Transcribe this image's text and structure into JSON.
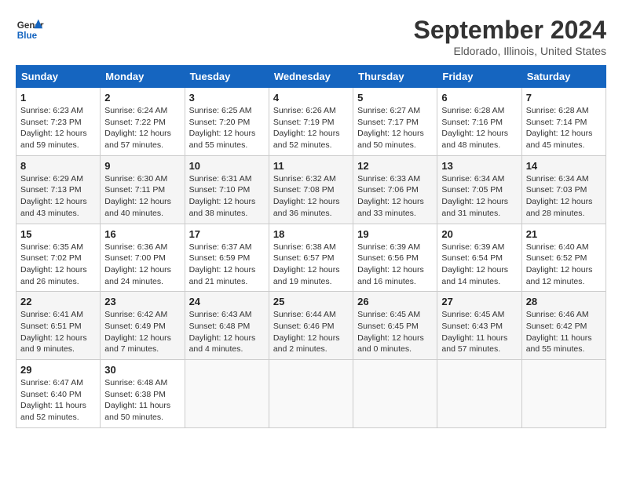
{
  "header": {
    "logo_line1": "General",
    "logo_line2": "Blue",
    "month": "September 2024",
    "location": "Eldorado, Illinois, United States"
  },
  "weekdays": [
    "Sunday",
    "Monday",
    "Tuesday",
    "Wednesday",
    "Thursday",
    "Friday",
    "Saturday"
  ],
  "weeks": [
    [
      {
        "day": "1",
        "info": "Sunrise: 6:23 AM\nSunset: 7:23 PM\nDaylight: 12 hours\nand 59 minutes."
      },
      {
        "day": "2",
        "info": "Sunrise: 6:24 AM\nSunset: 7:22 PM\nDaylight: 12 hours\nand 57 minutes."
      },
      {
        "day": "3",
        "info": "Sunrise: 6:25 AM\nSunset: 7:20 PM\nDaylight: 12 hours\nand 55 minutes."
      },
      {
        "day": "4",
        "info": "Sunrise: 6:26 AM\nSunset: 7:19 PM\nDaylight: 12 hours\nand 52 minutes."
      },
      {
        "day": "5",
        "info": "Sunrise: 6:27 AM\nSunset: 7:17 PM\nDaylight: 12 hours\nand 50 minutes."
      },
      {
        "day": "6",
        "info": "Sunrise: 6:28 AM\nSunset: 7:16 PM\nDaylight: 12 hours\nand 48 minutes."
      },
      {
        "day": "7",
        "info": "Sunrise: 6:28 AM\nSunset: 7:14 PM\nDaylight: 12 hours\nand 45 minutes."
      }
    ],
    [
      {
        "day": "8",
        "info": "Sunrise: 6:29 AM\nSunset: 7:13 PM\nDaylight: 12 hours\nand 43 minutes."
      },
      {
        "day": "9",
        "info": "Sunrise: 6:30 AM\nSunset: 7:11 PM\nDaylight: 12 hours\nand 40 minutes."
      },
      {
        "day": "10",
        "info": "Sunrise: 6:31 AM\nSunset: 7:10 PM\nDaylight: 12 hours\nand 38 minutes."
      },
      {
        "day": "11",
        "info": "Sunrise: 6:32 AM\nSunset: 7:08 PM\nDaylight: 12 hours\nand 36 minutes."
      },
      {
        "day": "12",
        "info": "Sunrise: 6:33 AM\nSunset: 7:06 PM\nDaylight: 12 hours\nand 33 minutes."
      },
      {
        "day": "13",
        "info": "Sunrise: 6:34 AM\nSunset: 7:05 PM\nDaylight: 12 hours\nand 31 minutes."
      },
      {
        "day": "14",
        "info": "Sunrise: 6:34 AM\nSunset: 7:03 PM\nDaylight: 12 hours\nand 28 minutes."
      }
    ],
    [
      {
        "day": "15",
        "info": "Sunrise: 6:35 AM\nSunset: 7:02 PM\nDaylight: 12 hours\nand 26 minutes."
      },
      {
        "day": "16",
        "info": "Sunrise: 6:36 AM\nSunset: 7:00 PM\nDaylight: 12 hours\nand 24 minutes."
      },
      {
        "day": "17",
        "info": "Sunrise: 6:37 AM\nSunset: 6:59 PM\nDaylight: 12 hours\nand 21 minutes."
      },
      {
        "day": "18",
        "info": "Sunrise: 6:38 AM\nSunset: 6:57 PM\nDaylight: 12 hours\nand 19 minutes."
      },
      {
        "day": "19",
        "info": "Sunrise: 6:39 AM\nSunset: 6:56 PM\nDaylight: 12 hours\nand 16 minutes."
      },
      {
        "day": "20",
        "info": "Sunrise: 6:39 AM\nSunset: 6:54 PM\nDaylight: 12 hours\nand 14 minutes."
      },
      {
        "day": "21",
        "info": "Sunrise: 6:40 AM\nSunset: 6:52 PM\nDaylight: 12 hours\nand 12 minutes."
      }
    ],
    [
      {
        "day": "22",
        "info": "Sunrise: 6:41 AM\nSunset: 6:51 PM\nDaylight: 12 hours\nand 9 minutes."
      },
      {
        "day": "23",
        "info": "Sunrise: 6:42 AM\nSunset: 6:49 PM\nDaylight: 12 hours\nand 7 minutes."
      },
      {
        "day": "24",
        "info": "Sunrise: 6:43 AM\nSunset: 6:48 PM\nDaylight: 12 hours\nand 4 minutes."
      },
      {
        "day": "25",
        "info": "Sunrise: 6:44 AM\nSunset: 6:46 PM\nDaylight: 12 hours\nand 2 minutes."
      },
      {
        "day": "26",
        "info": "Sunrise: 6:45 AM\nSunset: 6:45 PM\nDaylight: 12 hours\nand 0 minutes."
      },
      {
        "day": "27",
        "info": "Sunrise: 6:45 AM\nSunset: 6:43 PM\nDaylight: 11 hours\nand 57 minutes."
      },
      {
        "day": "28",
        "info": "Sunrise: 6:46 AM\nSunset: 6:42 PM\nDaylight: 11 hours\nand 55 minutes."
      }
    ],
    [
      {
        "day": "29",
        "info": "Sunrise: 6:47 AM\nSunset: 6:40 PM\nDaylight: 11 hours\nand 52 minutes."
      },
      {
        "day": "30",
        "info": "Sunrise: 6:48 AM\nSunset: 6:38 PM\nDaylight: 11 hours\nand 50 minutes."
      },
      {
        "day": "",
        "info": ""
      },
      {
        "day": "",
        "info": ""
      },
      {
        "day": "",
        "info": ""
      },
      {
        "day": "",
        "info": ""
      },
      {
        "day": "",
        "info": ""
      }
    ]
  ]
}
